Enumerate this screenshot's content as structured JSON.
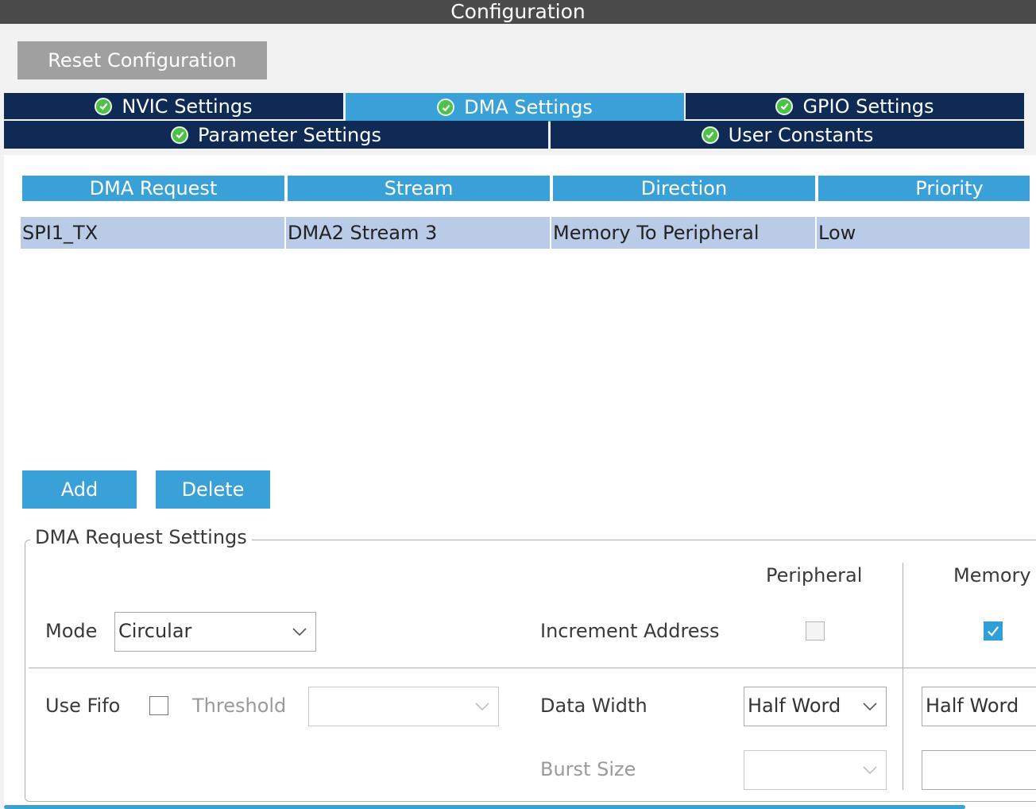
{
  "window": {
    "title": "Configuration"
  },
  "toolbar": {
    "reset_label": "Reset Configuration"
  },
  "tabs": {
    "nvic": "NVIC Settings",
    "dma": "DMA Settings",
    "gpio": "GPIO Settings",
    "parameter": "Parameter Settings",
    "user_constants": "User Constants",
    "active": "DMA Settings",
    "status_icon": "check-circle-icon"
  },
  "table": {
    "headers": [
      "DMA Request",
      "Stream",
      "Direction",
      "Priority"
    ],
    "rows": [
      [
        "SPI1_TX",
        "DMA2 Stream 3",
        "Memory To Peripheral",
        "Low"
      ]
    ]
  },
  "actions": {
    "add_label": "Add",
    "delete_label": "Delete"
  },
  "settings": {
    "title": "DMA Request Settings",
    "peripheral_header": "Peripheral",
    "memory_header": "Memory",
    "mode_label": "Mode",
    "mode_value": "Circular",
    "increment_label": "Increment Address",
    "peripheral_increment": false,
    "memory_increment": true,
    "use_fifo_label": "Use Fifo",
    "use_fifo": false,
    "threshold_label": "Threshold",
    "threshold_value": "",
    "data_width_label": "Data Width",
    "peripheral_data_width": "Half Word",
    "memory_data_width": "Half Word",
    "burst_size_label": "Burst Size",
    "peripheral_burst_size": "",
    "memory_burst_size": ""
  },
  "colors": {
    "tab_bg": "#0f2a55",
    "tab_active": "#3aa1d8",
    "header_bg": "#3aa1d8",
    "row_selected": "#b9cbe6",
    "check_green": "#4fc04a"
  }
}
